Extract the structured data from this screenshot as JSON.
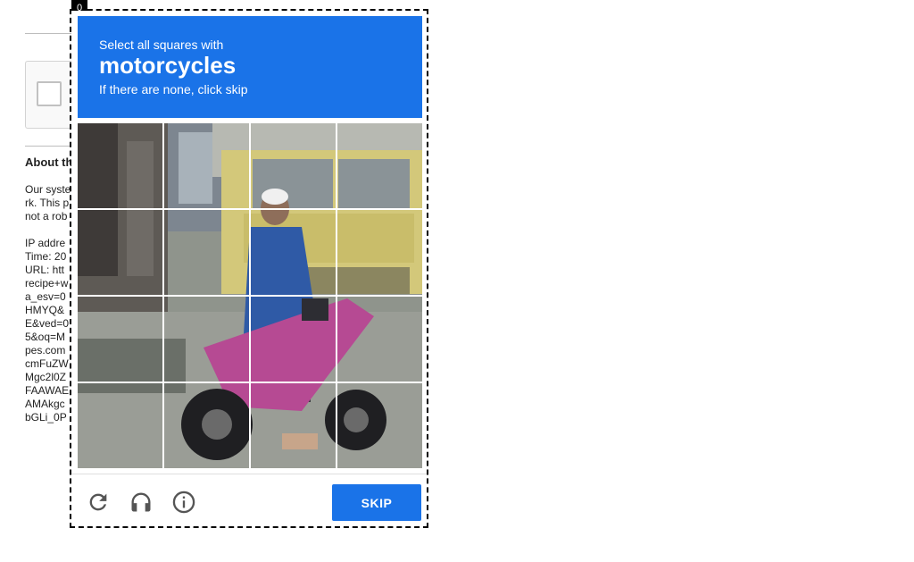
{
  "background_page": {
    "about_title": "About th",
    "text_lines": [
      "Our syste",
      "rk. This p",
      "not a rob",
      "",
      "IP addre",
      "Time: 20",
      "URL: htt",
      "recipe+w",
      "a_esv=0",
      "HMYQ&",
      "E&ved=0",
      "5&oq=M",
      "pes.com",
      "cmFuZW",
      "Mgc2l0Z",
      "FAAWAE",
      "AMAkgc",
      "bGLi_0P"
    ]
  },
  "counter": "0",
  "challenge": {
    "instruction_line1": "Select all squares with",
    "target_object": "motorcycles",
    "instruction_line3": "If there are none, click skip",
    "grid": {
      "rows": 4,
      "cols": 4
    },
    "skip_label": "SKIP"
  },
  "footer_icons": [
    "reload-icon",
    "headphones-icon",
    "info-icon"
  ],
  "colors": {
    "accent": "#1a73e8",
    "dashed_border": "#000000"
  }
}
